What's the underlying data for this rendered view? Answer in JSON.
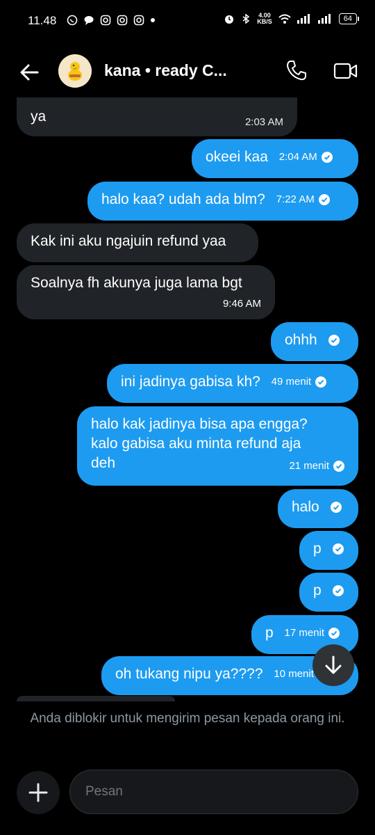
{
  "status_bar": {
    "time": "11.48",
    "net_speed_value": "4.00",
    "net_speed_unit": "KB/S",
    "battery": "64"
  },
  "header": {
    "title": "kana • ready C..."
  },
  "messages": [
    {
      "dir": "in",
      "text": "ya",
      "time": "2:03 AM"
    },
    {
      "dir": "out",
      "text": "okeei kaa",
      "time": "2:04 AM"
    },
    {
      "dir": "out",
      "text": "halo kaa? udah ada blm?",
      "time": "7:22 AM"
    },
    {
      "dir": "in",
      "text": "Kak ini aku ngajuin refund yaa",
      "time": ""
    },
    {
      "dir": "in",
      "text": "Soalnya fh akunya juga lama bgt",
      "time": "9:46 AM"
    },
    {
      "dir": "out",
      "text": "ohhh",
      "time": ""
    },
    {
      "dir": "out",
      "text": "ini jadinya gabisa kh?",
      "time": "49 menit"
    },
    {
      "dir": "out",
      "lines": [
        "halo kak jadinya bisa apa engga?",
        "kalo gabisa aku minta refund aja",
        "deh"
      ],
      "time": "21 menit"
    },
    {
      "dir": "out",
      "text": "halo",
      "time": ""
    },
    {
      "dir": "out",
      "text": "p",
      "time": ""
    },
    {
      "dir": "out",
      "text": "p",
      "time": ""
    },
    {
      "dir": "out",
      "text": "p",
      "time": "17 menit"
    },
    {
      "dir": "out",
      "text": "oh tukang nipu ya????",
      "time": "10 menit"
    }
  ],
  "blocked_notice": "Anda diblokir untuk mengirim pesan kepada orang ini.",
  "composer": {
    "placeholder": "Pesan"
  },
  "colors": {
    "background": "#000000",
    "outgoing_bubble": "#1d9bf0",
    "incoming_bubble": "#202327"
  }
}
